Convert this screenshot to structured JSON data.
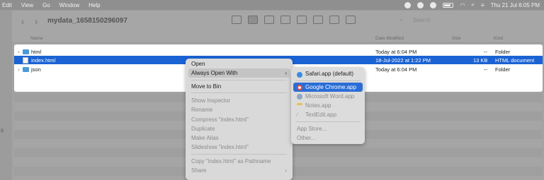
{
  "menubar": {
    "items": [
      "Edit",
      "View",
      "Go",
      "Window",
      "Help"
    ],
    "clock": "Thu 21 Jul 6:05 PM"
  },
  "window": {
    "title": "mydata_1658150296097",
    "back_icon": "chevron-left-icon",
    "forward_icon": "chevron-right-icon",
    "search_placeholder": "Search"
  },
  "columns": {
    "name": "Name",
    "date": "Date Modified",
    "size": "Size",
    "kind": "Kind"
  },
  "rows": [
    {
      "name": "html",
      "date": "Today at 6:04 PM",
      "size": "--",
      "kind": "Folder"
    },
    {
      "name": "index.html",
      "date": "18-Jul-2022 at 1:22 PM",
      "size": "13 KB",
      "kind": "HTML document"
    },
    {
      "name": "json",
      "date": "Today at 6:04 PM",
      "size": "--",
      "kind": "Folder"
    }
  ],
  "context_menu": {
    "open": "Open",
    "always_open_with": "Always Open With",
    "move_to_bin": "Move to Bin",
    "show_inspector": "Show Inspector",
    "rename": "Rename",
    "compress": "Compress \"index.html\"",
    "duplicate": "Duplicate",
    "make_alias": "Make Alias",
    "slideshow": "Slideshow \"index.html\"",
    "copy_pathname": "Copy \"index.html\" as Pathname",
    "share": "Share"
  },
  "submenu": {
    "safari": "Safari.app (default)",
    "chrome": "Google Chrome.app",
    "word": "Microsoft Word.app",
    "notes": "Notes.app",
    "textedit": "TextEdit.app",
    "app_store": "App Store...",
    "other": "Other..."
  },
  "sidebar_fragment": "s"
}
